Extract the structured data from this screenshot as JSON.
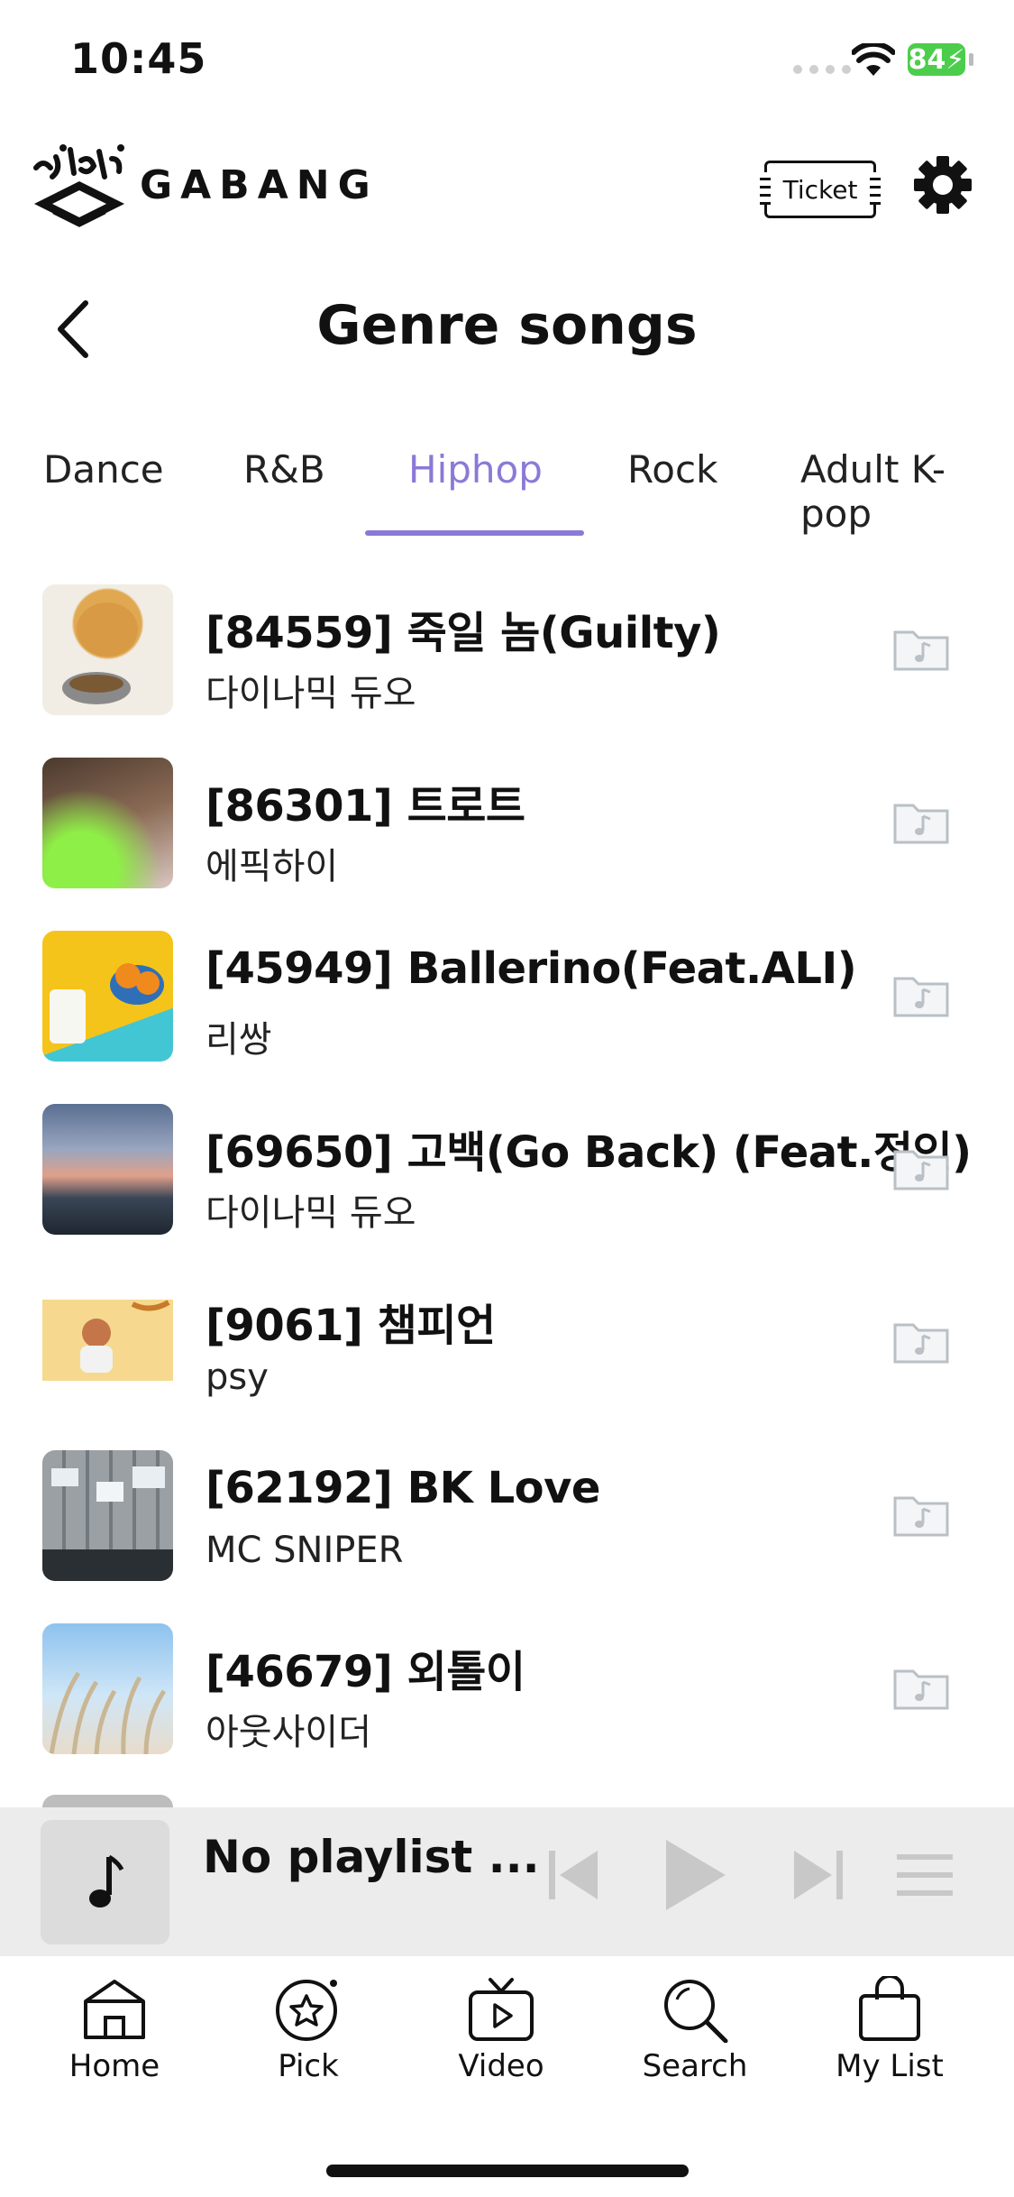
{
  "status_bar": {
    "time": "10:45",
    "battery": "84"
  },
  "header": {
    "brand": "GABANG",
    "ticket_label": "Ticket"
  },
  "page": {
    "title": "Genre songs"
  },
  "tabs": [
    {
      "label": "Dance",
      "active": false
    },
    {
      "label": "R&B",
      "active": false
    },
    {
      "label": "Hiphop",
      "active": true
    },
    {
      "label": "Rock",
      "active": false
    },
    {
      "label": "Adult K-pop",
      "active": false
    }
  ],
  "songs": [
    {
      "title": "[84559] 죽일 놈(Guilty)",
      "artist": "다이나믹 듀오"
    },
    {
      "title": "[86301] 트로트",
      "artist": "에픽하이"
    },
    {
      "title": "[45949] Ballerino(Feat.ALI)",
      "artist": "리쌍"
    },
    {
      "title": "[69650] 고백(Go Back) (Feat.정인)",
      "artist": "다이나믹 듀오"
    },
    {
      "title": "[9061] 챔피언",
      "artist": "psy"
    },
    {
      "title": "[62192] BK Love",
      "artist": "MC SNIPER"
    },
    {
      "title": "[46679] 외톨이",
      "artist": "아웃사이더"
    }
  ],
  "player": {
    "title": "No playlist ..."
  },
  "nav": [
    {
      "label": "Home",
      "icon": "home-icon"
    },
    {
      "label": "Pick",
      "icon": "star-icon"
    },
    {
      "label": "Video",
      "icon": "tv-icon"
    },
    {
      "label": "Search",
      "icon": "search-icon"
    },
    {
      "label": "My List",
      "icon": "bag-icon"
    }
  ],
  "colors": {
    "accent": "#8b79d6",
    "player_bg": "#ececec",
    "battery": "#4ccd4c"
  }
}
